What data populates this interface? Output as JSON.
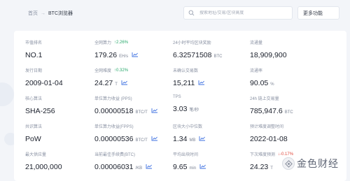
{
  "breadcrumb": {
    "home": "首页",
    "separator": "→",
    "current": "BTC浏览器"
  },
  "search": {
    "placeholder": "搜索地址/交易/区块高度"
  },
  "more_menu": {
    "label": "更多功能"
  },
  "stats": [
    {
      "label": "市值排名",
      "value": "NO.1",
      "unit": "",
      "change": "",
      "trend": false
    },
    {
      "label": "全网算力",
      "value": "179.26",
      "unit": "EH/s",
      "change": "↑2.26%",
      "change_dir": "up",
      "trend": true
    },
    {
      "label": "24小时平均区块奖励",
      "value": "6.32571508",
      "unit": "BTC",
      "change": "",
      "trend": false
    },
    {
      "label": "流通量",
      "value": "18,909,900",
      "unit": "",
      "change": "",
      "trend": false
    },
    {
      "label": "发行日期",
      "value": "2009-01-04",
      "unit": "",
      "change": "",
      "trend": false
    },
    {
      "label": "全网难度",
      "value": "24.27",
      "unit": "T",
      "change": "↑0.32%",
      "change_dir": "up",
      "trend": true
    },
    {
      "label": "未确认交易数",
      "value": "15,211",
      "unit": "",
      "change": "",
      "trend": true
    },
    {
      "label": "流通率",
      "value": "90.05",
      "unit": "%",
      "change": "",
      "trend": false
    },
    {
      "label": "核心算法",
      "value": "SHA-256",
      "unit": "",
      "change": "",
      "trend": false
    },
    {
      "label": "单位算力收益 (PPS)",
      "value": "0.00000518",
      "unit": "BTC/T",
      "change": "",
      "trend": true
    },
    {
      "label": "TPS",
      "value": "3.03",
      "unit": "笔/秒",
      "change": "",
      "trend": false
    },
    {
      "label": "24h 链上交易量",
      "value": "785,947.6",
      "unit": "BTC",
      "change": "",
      "trend": false
    },
    {
      "label": "共识算法",
      "value": "PoW",
      "unit": "",
      "change": "",
      "trend": false
    },
    {
      "label": "单位算力收益(FPPS)",
      "value": "0.00000536",
      "unit": "BTC/T",
      "change": "",
      "trend": true
    },
    {
      "label": "区块大小中位数",
      "value": "1.34",
      "unit": "MB",
      "change": "",
      "trend": true
    },
    {
      "label": "预计难度调整时间",
      "value": "2022-01-08",
      "unit": "",
      "change": "",
      "trend": false
    },
    {
      "label": "最大供应量",
      "value": "21,000,000",
      "unit": "",
      "change": "",
      "trend": false
    },
    {
      "label": "当前最佳手续费(BTC)",
      "value": "0.00006031",
      "unit": "/KB",
      "change": "",
      "trend": true
    },
    {
      "label": "平均出块时间",
      "value": "9.65",
      "unit": "min",
      "change": "",
      "trend": true
    },
    {
      "label": "下次难度预测",
      "value": "24.23",
      "unit": "T",
      "change": "↓-0.17%",
      "change_dir": "down",
      "trend": false
    }
  ],
  "watermark": {
    "text": "金色财经"
  },
  "colors": {
    "accent": "#3b6fe0",
    "up": "#27a86b",
    "down": "#e0483c"
  }
}
